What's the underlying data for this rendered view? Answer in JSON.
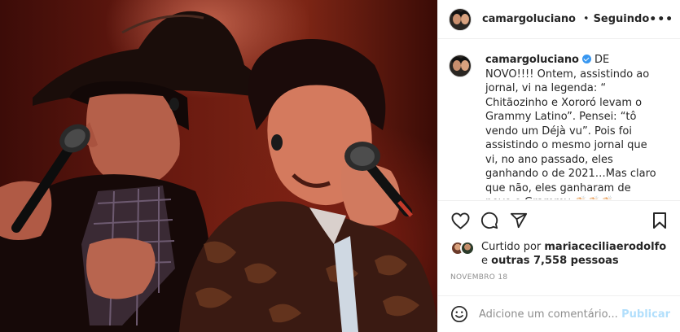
{
  "post": {
    "username": "camargoluciano",
    "follow_status": "Seguindo",
    "separator": "•",
    "more_icon": "•••"
  },
  "caption": {
    "username": "camargoluciano",
    "text": "DE NOVO!!!! Ontem, assistindo ao jornal, vi na legenda: “ Chitãozinho e Xororó levam o Grammy Latino”. Pensei: “tô vendo um Déjà vu”. Pois foi assistindo o mesmo jornal que vi, no ano passado, eles ganhando o de 2021…Mas claro que não, eles ganharam de novo o Grammy 👏🏻👏🏻👏🏻 Meninos, vcs ganharam o mundo faz tempo! Mas para nós"
  },
  "actions": {
    "like": "heart-icon",
    "comment": "comment-icon",
    "share": "share-icon",
    "save": "bookmark-icon"
  },
  "likes": {
    "prefix": "Curtido por ",
    "user": "mariaceciliaerodolfo",
    "middle": " e ",
    "others": "outras 7,558 pessoas"
  },
  "date": "NOVEMBRO 18",
  "comment_box": {
    "placeholder": "Adicione um comentário...",
    "post_label": "Publicar"
  },
  "colors": {
    "accent_blue": "#3897f0",
    "post_disabled": "#b2dffc",
    "border": "#efefef",
    "muted_text": "#8e8e8e"
  }
}
